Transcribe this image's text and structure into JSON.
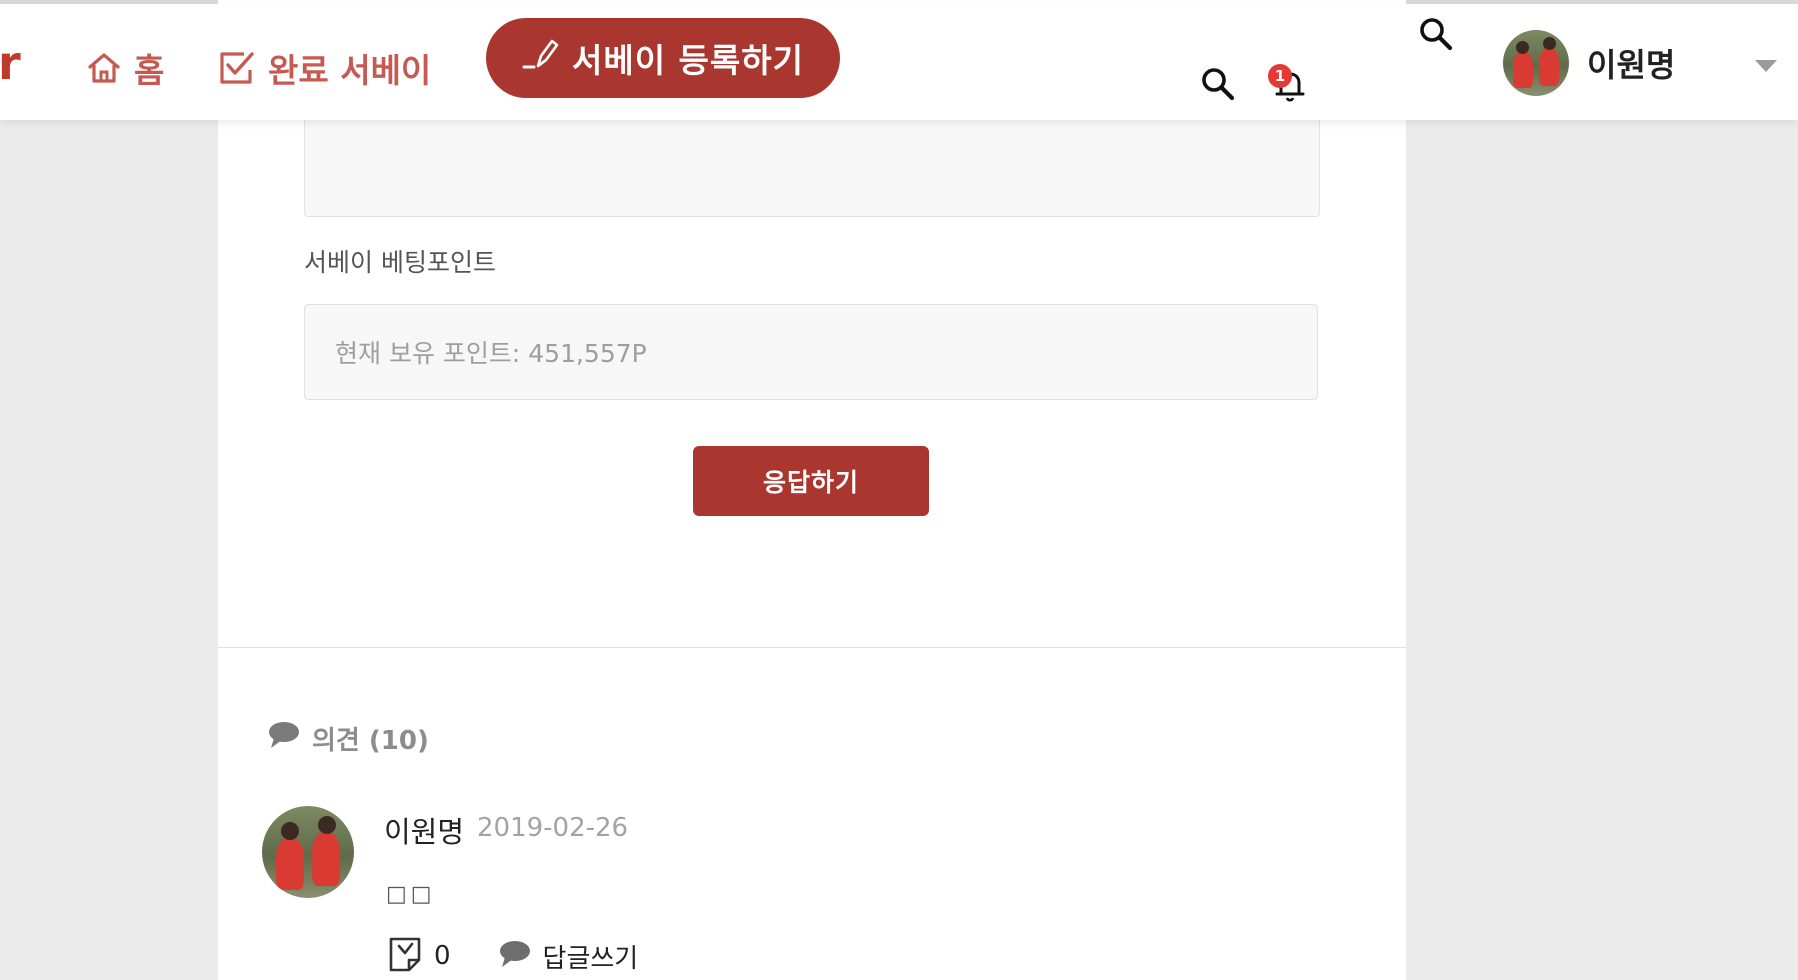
{
  "header": {
    "logo_fragment": "r",
    "nav": [
      {
        "label": "홈",
        "icon": "home-icon"
      },
      {
        "label": "완료 서베이",
        "icon": "checked-box-icon"
      }
    ],
    "register_label": "서베이 등록하기",
    "register_icon": "pencil-icon",
    "notification_count": "1",
    "user_name": "이원명",
    "accent_color": "#a93730"
  },
  "form": {
    "betting_label": "서베이 베팅포인트",
    "points_placeholder": "현재 보유 포인트: 451,557P",
    "submit_label": "응답하기"
  },
  "comments": {
    "heading": "의견 (10)",
    "items": [
      {
        "author": "이원명",
        "date": "2019-02-26",
        "body": "□□",
        "like_count": "0",
        "reply_label": "답글쓰기"
      }
    ]
  }
}
